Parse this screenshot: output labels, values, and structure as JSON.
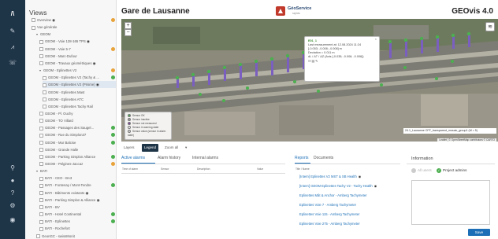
{
  "sidebar": {
    "title": "Views",
    "items": [
      {
        "label": "Overview",
        "eye": true,
        "dot": "#e8a33a"
      },
      {
        "label": "Vue générale"
      },
      {
        "label": "GEOM",
        "group": true
      },
      {
        "label": "GEOM - Voie 128-165 TPS",
        "eye": true
      },
      {
        "label": "GEOM - Voie 5-7",
        "dot": "#e8a33a"
      },
      {
        "label": "GEOM - Marc-Dufour"
      },
      {
        "label": "GEOM - Travaux géométriques",
        "eye": true
      },
      {
        "label": "GEOM - Eplinettes V2",
        "group": true,
        "dot": "#e8a33a"
      },
      {
        "label": "GEOM - Eplinettes V2 (Tachy & ...",
        "dot": "#4caf50"
      },
      {
        "label": "GEOM - Eplinettes V2 (Prisme)",
        "eye": true,
        "selected": true
      },
      {
        "label": "GEOM - Eplinettes Mast"
      },
      {
        "label": "GEOM - Eplinettes ATC"
      },
      {
        "label": "GEOM - Eplinettes Tachy Rail"
      },
      {
        "label": "GEOM - Pl. Ouchy"
      },
      {
        "label": "GEOM - TO Villard"
      },
      {
        "label": "GEOM - Passages des Saugel...",
        "dot": "#4caf50"
      },
      {
        "label": "GEOM - Rue du Simplon37",
        "dot": "#4caf50"
      },
      {
        "label": "GEOM - Mur Balcise",
        "dot": "#4caf50"
      },
      {
        "label": "GEOM - Grande Halle"
      },
      {
        "label": "GEOM - Parking Simplon Alliance",
        "dot": "#4caf50"
      },
      {
        "label": "GEOM - Pelgines-Jaccaz",
        "dot": "#e8a33a"
      },
      {
        "label": "BATI",
        "group": true
      },
      {
        "label": "BATI - CEO - BA3"
      },
      {
        "label": "BATI - Fontenay / Mont-Tendre",
        "dot": "#4caf50"
      },
      {
        "label": "BATI - Bâtiments existants",
        "eye": true
      },
      {
        "label": "BATI - Parking Simplon & Alliance",
        "eye": true
      },
      {
        "label": "BATI - BV"
      },
      {
        "label": "BATI - Hotel Continental",
        "dot": "#4caf50"
      },
      {
        "label": "BATI - Eplinettes",
        "dot": "#4caf50"
      },
      {
        "label": "BATI - Rochefort"
      },
      {
        "label": "GeonGC - swissMonit"
      }
    ]
  },
  "header": {
    "title": "Gare de Lausanne",
    "logo_name": "GéoService",
    "logo_sub": "rapido",
    "app_version": "GEOvis 4.0"
  },
  "map": {
    "zoom_in": "+",
    "zoom_out": "−",
    "popup": {
      "title": "E01_1",
      "line1": "Last measurement at: 12.08.2024 11:24",
      "line2": "[-0.053; -0.008; -0.008] m",
      "line3": "Deviation = 0.011 m",
      "line4": "dL / ΔT / ΔZ (Axis [-0.035; -0.006; -0.006])",
      "close": "×"
    },
    "legend": [
      {
        "label": "Sensor OK",
        "color": "#4caf50"
      },
      {
        "label": "Sensor inactive",
        "color": "#9e9e9e"
      },
      {
        "label": "Sensor not measured",
        "color": "#7b3fa0"
      },
      {
        "label": "Sensor in warning state",
        "color": "#ffffff"
      },
      {
        "label": "Sensor value (sensor in alarm state)",
        "color": "#d9d9d9"
      }
    ],
    "caption": "24.1_Lausanne CFF_transparent_mosaic_group1 (M = 5)",
    "attribution": "Leaflet | © OpenStreetMap contributors © CARTO"
  },
  "map_tabs": [
    "Layers",
    "Legend",
    "Zoom all"
  ],
  "alarms": {
    "tabs": [
      "Active alarms",
      "Alarm history",
      "Internal alarms"
    ],
    "columns": [
      "Time of alarm",
      "Sensor",
      "Description",
      "Value"
    ]
  },
  "reports": {
    "tabs": [
      "Reports",
      "Documents"
    ],
    "filter_header": "Title / Name",
    "items": [
      {
        "label": "[Intern] Eplinettes V2 MST & SB Health",
        "eye": true
      },
      {
        "label": "[Intern] GEOM Eplinettes Tachy V2 - Tachy Health",
        "eye": true
      },
      {
        "label": "Eplinettes Mât & Anchor - Amberg Tachymeter"
      },
      {
        "label": "Eplinettes Voie 7 - Amberg Tachymeter"
      },
      {
        "label": "Eplinettes Voie 115 - Amberg Tachymeter"
      },
      {
        "label": "Eplinettes Voie 275 - Amberg Tachymeter"
      }
    ]
  },
  "info": {
    "title": "Information",
    "options": [
      "All users",
      "Project admins"
    ],
    "save_label": "Save"
  },
  "colors": {
    "accent": "#1c6fb6",
    "rail": "#1e3447",
    "ok": "#4caf50"
  }
}
